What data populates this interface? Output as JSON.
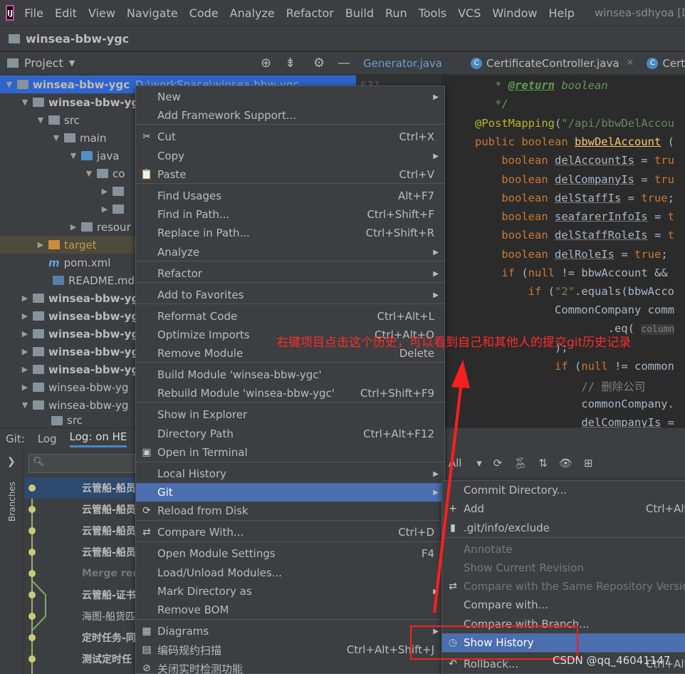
{
  "menubar": {
    "items": [
      "File",
      "Edit",
      "View",
      "Navigate",
      "Code",
      "Analyze",
      "Refactor",
      "Build",
      "Run",
      "Tools",
      "VCS",
      "Window",
      "Help"
    ],
    "title": "winsea-sdhyoa [D:\\wo"
  },
  "breadcrumb": "winsea-bbw-ygc",
  "project_panel": {
    "title": "Project",
    "tree": [
      {
        "label": "winsea-bbw-ygc",
        "suffix": "D:\\workSpace\\winsea-bbw-ygc"
      },
      {
        "label": "winsea-bbw-yg"
      },
      {
        "label": "src"
      },
      {
        "label": "main"
      },
      {
        "label": "java"
      },
      {
        "label": "co"
      },
      {
        "label": ""
      },
      {
        "label": ""
      },
      {
        "label": "resour"
      },
      {
        "label": "target"
      },
      {
        "label": "pom.xml"
      },
      {
        "label": "README.md"
      },
      {
        "label": "winsea-bbw-yg"
      },
      {
        "label": "winsea-bbw-yg"
      },
      {
        "label": "winsea-bbw-yg"
      },
      {
        "label": "winsea-bbw-yg"
      },
      {
        "label": "winsea-bbw-yg"
      },
      {
        "label": "winsea-bbw-yg"
      },
      {
        "label": "winsea-bbw-yg"
      },
      {
        "label": "src"
      }
    ]
  },
  "editor": {
    "tabs": [
      "Generator.java",
      "CertificateController.java",
      "Certif"
    ],
    "line_number": "631",
    "lines": [
      "   * @return boolean",
      "   */",
      "@PostMapping(\"/api/bbwDelAccou",
      "public boolean bbwDelAccount (",
      "    boolean delAccountIs = tru",
      "    boolean delCompanyIs = tru",
      "    boolean delStaffIs = true;",
      "    boolean seafarerInfoIs = t",
      "    boolean delStaffRoleIs = t",
      "    boolean delRoleIs = true;",
      "    if (null != bbwAccount &&",
      "        if (\"2\".equals(bbwAcco",
      "            CommonCompany comm",
      "                    .eq( colum",
      "            );",
      "            if (null != common",
      "                // 删除公司",
      "                commonCompany.",
      "                delCompanyIs ="
    ]
  },
  "bottom": {
    "tabs": [
      "Git:",
      "Log",
      "Log: on HE"
    ],
    "branches_label": "Branches",
    "git_filter": "All",
    "log_rows": [
      "云管船-船员",
      "云管船-船员",
      "云管船-船员",
      "云管船-船员",
      "Merge rem",
      "云管船-证书",
      "海图-船货匹",
      "定时任务-同",
      "测试定时任"
    ]
  },
  "context_menu": {
    "items": [
      {
        "label": "New",
        "shortcut": "",
        "submenu": true
      },
      {
        "label": "Add Framework Support...",
        "shortcut": ""
      },
      {
        "label": "Cut",
        "shortcut": "Ctrl+X",
        "icon": "✂"
      },
      {
        "label": "Copy",
        "shortcut": "",
        "submenu": true
      },
      {
        "label": "Paste",
        "shortcut": "Ctrl+V",
        "icon": "📋"
      },
      {
        "label": "Find Usages",
        "shortcut": "Alt+F7"
      },
      {
        "label": "Find in Path...",
        "shortcut": "Ctrl+Shift+F"
      },
      {
        "label": "Replace in Path...",
        "shortcut": "Ctrl+Shift+R"
      },
      {
        "label": "Analyze",
        "shortcut": "",
        "submenu": true
      },
      {
        "label": "Refactor",
        "shortcut": "",
        "submenu": true
      },
      {
        "label": "Add to Favorites",
        "shortcut": "",
        "submenu": true
      },
      {
        "label": "Reformat Code",
        "shortcut": "Ctrl+Alt+L"
      },
      {
        "label": "Optimize Imports",
        "shortcut": "Ctrl+Alt+O"
      },
      {
        "label": "Remove Module",
        "shortcut": "Delete"
      },
      {
        "label": "Build Module 'winsea-bbw-ygc'",
        "shortcut": ""
      },
      {
        "label": "Rebuild Module 'winsea-bbw-ygc'",
        "shortcut": "Ctrl+Shift+F9"
      },
      {
        "label": "Show in Explorer",
        "shortcut": ""
      },
      {
        "label": "Directory Path",
        "shortcut": "Ctrl+Alt+F12"
      },
      {
        "label": "Open in Terminal",
        "shortcut": "",
        "icon": "▣"
      },
      {
        "label": "Local History",
        "shortcut": "",
        "submenu": true
      },
      {
        "label": "Git",
        "shortcut": "",
        "submenu": true
      },
      {
        "label": "Reload from Disk",
        "shortcut": "",
        "icon": "⟳"
      },
      {
        "label": "Compare With...",
        "shortcut": "Ctrl+D",
        "icon": "⇄"
      },
      {
        "label": "Open Module Settings",
        "shortcut": "F4"
      },
      {
        "label": "Load/Unload Modules...",
        "shortcut": ""
      },
      {
        "label": "Mark Directory as",
        "shortcut": "",
        "submenu": true
      },
      {
        "label": "Remove BOM",
        "shortcut": ""
      },
      {
        "label": "Diagrams",
        "shortcut": "",
        "submenu": true,
        "icon": "▦"
      },
      {
        "label": "编码规约扫描",
        "shortcut": "Ctrl+Alt+Shift+J",
        "icon": "▤"
      },
      {
        "label": "关闭实时检测功能",
        "shortcut": "",
        "icon": "⊘"
      }
    ]
  },
  "git_submenu": {
    "items": [
      {
        "label": "Commit Directory...",
        "shortcut": ""
      },
      {
        "label": "Add",
        "shortcut": "Ctrl+Alt+",
        "icon": "+"
      },
      {
        "label": ".git/info/exclude",
        "shortcut": "",
        "icon": "▮"
      },
      {
        "label": "Annotate",
        "shortcut": "",
        "disabled": true
      },
      {
        "label": "Show Current Revision",
        "shortcut": "",
        "disabled": true
      },
      {
        "label": "Compare with the Same Repository Version",
        "shortcut": "",
        "disabled": true,
        "icon": "⇄"
      },
      {
        "label": "Compare with...",
        "shortcut": ""
      },
      {
        "label": "Compare with Branch...",
        "shortcut": ""
      },
      {
        "label": "Show History",
        "shortcut": "",
        "icon": "◷"
      },
      {
        "label": "Rollback...",
        "shortcut": "Ctrl+Alt+",
        "icon": "↶"
      }
    ]
  },
  "annotation": "右键项目点击这个历史，可以看到自己和其他人的提交git历史记录",
  "watermark": "CSDN @qq_46041147",
  "colors": {
    "selection": "#4b6eaf",
    "annotation": "#ff2a2a"
  }
}
